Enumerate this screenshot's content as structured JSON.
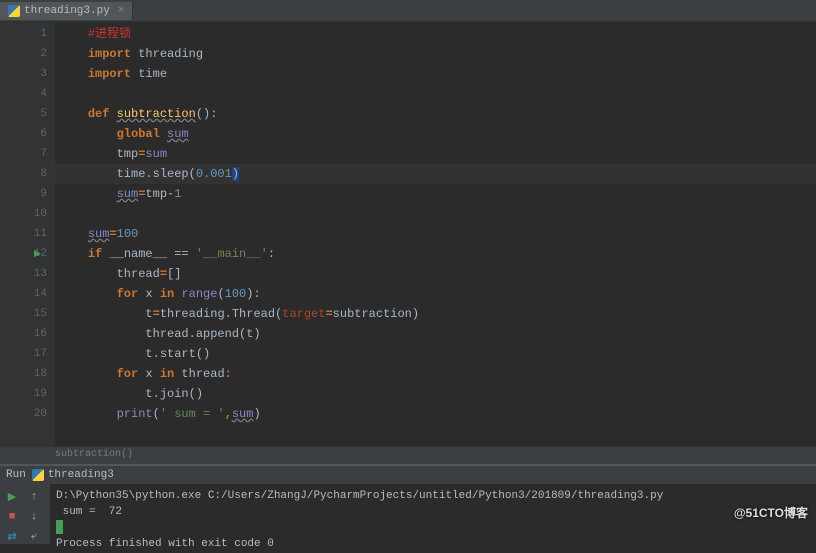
{
  "tab": {
    "name": "threading3.py",
    "close": "×"
  },
  "code": {
    "lines": [
      {
        "n": 1,
        "tokens": [
          {
            "t": "    ",
            "c": ""
          },
          {
            "t": "#进程锁",
            "c": "c-red"
          }
        ]
      },
      {
        "n": 2,
        "tokens": [
          {
            "t": "    ",
            "c": ""
          },
          {
            "t": "import",
            "c": "c-keyword"
          },
          {
            "t": " threading",
            "c": ""
          }
        ]
      },
      {
        "n": 3,
        "tokens": [
          {
            "t": "    ",
            "c": ""
          },
          {
            "t": "import",
            "c": "c-keyword"
          },
          {
            "t": " time",
            "c": ""
          }
        ]
      },
      {
        "n": 4,
        "tokens": []
      },
      {
        "n": 5,
        "tokens": [
          {
            "t": "    ",
            "c": ""
          },
          {
            "t": "def ",
            "c": "c-keyword"
          },
          {
            "t": "subtraction",
            "c": "c-func c-underline"
          },
          {
            "t": "():",
            "c": ""
          }
        ]
      },
      {
        "n": 6,
        "tokens": [
          {
            "t": "        ",
            "c": ""
          },
          {
            "t": "global",
            "c": "c-keyword"
          },
          {
            "t": " ",
            "c": ""
          },
          {
            "t": "sum",
            "c": "c-builtin c-underline"
          }
        ]
      },
      {
        "n": 7,
        "tokens": [
          {
            "t": "        tmp",
            "c": ""
          },
          {
            "t": "=",
            "c": "c-keyword"
          },
          {
            "t": "sum",
            "c": "c-builtin"
          }
        ]
      },
      {
        "n": 8,
        "current": true,
        "tokens": [
          {
            "t": "        time.sleep",
            "c": ""
          },
          {
            "t": "(",
            "c": ""
          },
          {
            "t": "0.001",
            "c": "c-number"
          },
          {
            "t": ")",
            "c": "highlight-caret"
          }
        ]
      },
      {
        "n": 9,
        "tokens": [
          {
            "t": "        ",
            "c": ""
          },
          {
            "t": "sum",
            "c": "c-builtin c-underline"
          },
          {
            "t": "=",
            "c": "c-keyword"
          },
          {
            "t": "tmp",
            "c": ""
          },
          {
            "t": "-",
            "c": "c-keyword"
          },
          {
            "t": "1",
            "c": "c-number"
          }
        ]
      },
      {
        "n": 10,
        "tokens": []
      },
      {
        "n": 11,
        "tokens": [
          {
            "t": "    ",
            "c": ""
          },
          {
            "t": "sum",
            "c": "c-builtin c-underline"
          },
          {
            "t": "=",
            "c": "c-keyword"
          },
          {
            "t": "100",
            "c": "c-number"
          }
        ]
      },
      {
        "n": 12,
        "play": true,
        "tokens": [
          {
            "t": "    ",
            "c": ""
          },
          {
            "t": "if",
            "c": "c-keyword"
          },
          {
            "t": " __name__ ",
            "c": ""
          },
          {
            "t": "==",
            "c": ""
          },
          {
            "t": " ",
            "c": ""
          },
          {
            "t": "'__main__'",
            "c": "c-string"
          },
          {
            "t": ":",
            "c": ""
          }
        ]
      },
      {
        "n": 13,
        "tokens": [
          {
            "t": "        thread",
            "c": ""
          },
          {
            "t": "=",
            "c": "c-keyword"
          },
          {
            "t": "[]",
            "c": ""
          }
        ]
      },
      {
        "n": 14,
        "tokens": [
          {
            "t": "        ",
            "c": ""
          },
          {
            "t": "for",
            "c": "c-keyword"
          },
          {
            "t": " x ",
            "c": ""
          },
          {
            "t": "in",
            "c": "c-keyword"
          },
          {
            "t": " ",
            "c": ""
          },
          {
            "t": "range",
            "c": "c-builtin"
          },
          {
            "t": "(",
            "c": ""
          },
          {
            "t": "100",
            "c": "c-number"
          },
          {
            "t": "):",
            "c": ""
          }
        ]
      },
      {
        "n": 15,
        "tokens": [
          {
            "t": "            t",
            "c": ""
          },
          {
            "t": "=",
            "c": "c-keyword"
          },
          {
            "t": "threading.Thread(",
            "c": ""
          },
          {
            "t": "target",
            "c": "c-param"
          },
          {
            "t": "=",
            "c": "c-keyword"
          },
          {
            "t": "subtraction)",
            "c": ""
          }
        ]
      },
      {
        "n": 16,
        "tokens": [
          {
            "t": "            thread.append(t)",
            "c": ""
          }
        ]
      },
      {
        "n": 17,
        "tokens": [
          {
            "t": "            t.start()",
            "c": ""
          }
        ]
      },
      {
        "n": 18,
        "tokens": [
          {
            "t": "        ",
            "c": ""
          },
          {
            "t": "for",
            "c": "c-keyword"
          },
          {
            "t": " x ",
            "c": ""
          },
          {
            "t": "in",
            "c": "c-keyword"
          },
          {
            "t": " thread",
            "c": ""
          },
          {
            "t": ":",
            "c": "c-keyword"
          }
        ]
      },
      {
        "n": 19,
        "tokens": [
          {
            "t": "            t.join()",
            "c": ""
          }
        ]
      },
      {
        "n": 20,
        "tokens": [
          {
            "t": "        ",
            "c": ""
          },
          {
            "t": "print",
            "c": "c-builtin"
          },
          {
            "t": "(",
            "c": ""
          },
          {
            "t": "' sum = '",
            "c": "c-string"
          },
          {
            "t": ",",
            "c": "c-keyword"
          },
          {
            "t": "sum",
            "c": "c-builtin c-underline"
          },
          {
            "t": ")",
            "c": ""
          }
        ]
      }
    ]
  },
  "breadcrumb": "subtraction()",
  "run": {
    "header": "Run",
    "title": "threading3",
    "output": {
      "line1": "D:\\Python35\\python.exe C:/Users/ZhangJ/PycharmProjects/untitled/Python3/201809/threading3.py",
      "line2": " sum =  72",
      "line4": "Process finished with exit code 0"
    }
  },
  "watermark": "@51CTO博客"
}
